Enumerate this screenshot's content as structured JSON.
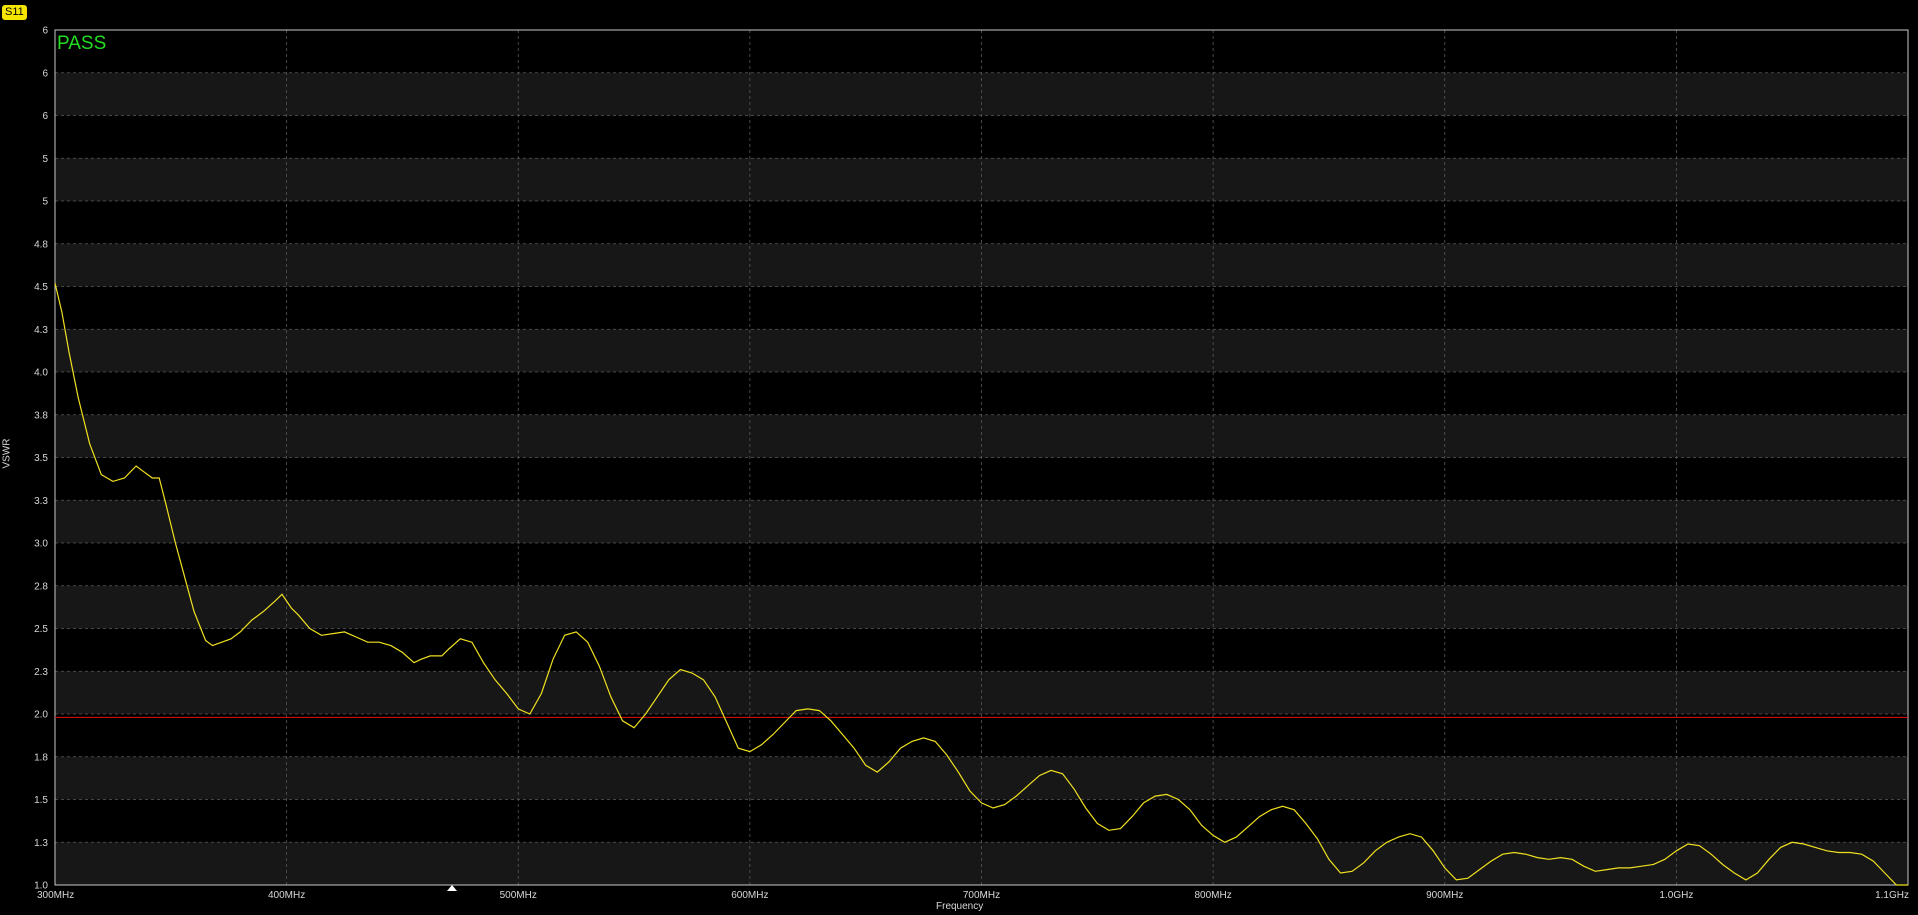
{
  "trace_badge": "S11",
  "status": "PASS",
  "chart_data": {
    "type": "line",
    "xlabel": "Frequency",
    "ylabel": "VSWR",
    "x_tick_labels": [
      "300MHz",
      "400MHz",
      "500MHz",
      "600MHz",
      "700MHz",
      "800MHz",
      "900MHz",
      "1.0GHz",
      "1.1GHz"
    ],
    "y_tick_labels": [
      "6",
      "6",
      "6",
      "5",
      "5",
      "4.8",
      "4.5",
      "4.3",
      "4.0",
      "3.8",
      "3.5",
      "3.3",
      "3.0",
      "2.8",
      "2.5",
      "2.3",
      "2.0",
      "1.8",
      "1.5",
      "1.3",
      "1.0"
    ],
    "xlim_mhz": [
      300,
      1100
    ],
    "limit_line": {
      "value": 1.98,
      "color": "#e01010"
    },
    "trace_color": "#f0e020",
    "series": [
      {
        "x_mhz": [
          300,
          303,
          306,
          310,
          315,
          320,
          325,
          330,
          335,
          338,
          342,
          345,
          348,
          352,
          356,
          360,
          365,
          368,
          372,
          376,
          380,
          385,
          390,
          395,
          398,
          402,
          405,
          410,
          415,
          420,
          425,
          430,
          435,
          440,
          445,
          450,
          455,
          458,
          462,
          467,
          470,
          475,
          480,
          485,
          490,
          495,
          500,
          505,
          510,
          515,
          520,
          525,
          530,
          535,
          540,
          545,
          550,
          555,
          560,
          565,
          570,
          575,
          580,
          585,
          590,
          595,
          600,
          605,
          610,
          615,
          620,
          625,
          630,
          635,
          640,
          645,
          650,
          655,
          660,
          665,
          670,
          675,
          680,
          685,
          690,
          695,
          700,
          705,
          710,
          715,
          720,
          725,
          730,
          735,
          740,
          745,
          750,
          755,
          760,
          765,
          770,
          775,
          780,
          785,
          790,
          795,
          800,
          805,
          810,
          815,
          820,
          825,
          830,
          835,
          840,
          845,
          850,
          855,
          860,
          865,
          870,
          875,
          880,
          885,
          890,
          895,
          900,
          905,
          910,
          915,
          920,
          925,
          930,
          935,
          940,
          945,
          950,
          955,
          960,
          965,
          970,
          975,
          980,
          985,
          990,
          995,
          1000,
          1005,
          1010,
          1015,
          1020,
          1025,
          1030,
          1035,
          1040,
          1045,
          1050,
          1055,
          1060,
          1065,
          1070,
          1075,
          1080,
          1085,
          1090,
          1095,
          1100
        ],
        "y": [
          4.52,
          4.35,
          4.12,
          3.85,
          3.58,
          3.4,
          3.36,
          3.38,
          3.45,
          3.42,
          3.38,
          3.38,
          3.22,
          3.0,
          2.8,
          2.6,
          2.43,
          2.4,
          2.42,
          2.44,
          2.48,
          2.55,
          2.6,
          2.66,
          2.7,
          2.62,
          2.58,
          2.5,
          2.46,
          2.47,
          2.48,
          2.45,
          2.42,
          2.42,
          2.4,
          2.36,
          2.3,
          2.32,
          2.34,
          2.34,
          2.38,
          2.44,
          2.42,
          2.3,
          2.2,
          2.12,
          2.03,
          2.0,
          2.12,
          2.32,
          2.46,
          2.48,
          2.42,
          2.28,
          2.1,
          1.96,
          1.92,
          2.0,
          2.1,
          2.2,
          2.26,
          2.24,
          2.2,
          2.1,
          1.95,
          1.8,
          1.78,
          1.82,
          1.88,
          1.95,
          2.02,
          2.03,
          2.02,
          1.96,
          1.88,
          1.8,
          1.7,
          1.66,
          1.72,
          1.8,
          1.84,
          1.86,
          1.84,
          1.76,
          1.66,
          1.55,
          1.48,
          1.45,
          1.47,
          1.52,
          1.58,
          1.64,
          1.67,
          1.65,
          1.56,
          1.45,
          1.36,
          1.32,
          1.33,
          1.4,
          1.48,
          1.52,
          1.53,
          1.5,
          1.44,
          1.35,
          1.29,
          1.25,
          1.28,
          1.34,
          1.4,
          1.44,
          1.46,
          1.44,
          1.36,
          1.27,
          1.15,
          1.07,
          1.08,
          1.13,
          1.2,
          1.25,
          1.28,
          1.3,
          1.28,
          1.2,
          1.1,
          1.03,
          1.04,
          1.09,
          1.14,
          1.18,
          1.19,
          1.18,
          1.16,
          1.15,
          1.16,
          1.15,
          1.11,
          1.08,
          1.09,
          1.1,
          1.1,
          1.11,
          1.12,
          1.15,
          1.2,
          1.24,
          1.23,
          1.18,
          1.12,
          1.07,
          1.03,
          1.07,
          1.15,
          1.22,
          1.25,
          1.24,
          1.22,
          1.2,
          1.19,
          1.19,
          1.18,
          1.14,
          1.07
        ]
      }
    ]
  }
}
